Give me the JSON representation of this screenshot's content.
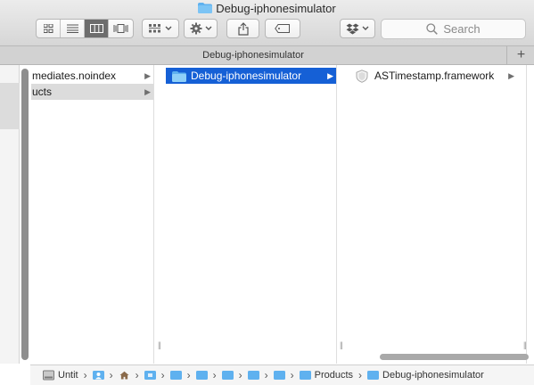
{
  "window": {
    "title": "Debug-iphonesimulator"
  },
  "toolbar": {
    "view_modes": [
      "icon-view",
      "list-view",
      "column-view",
      "cover-flow-view"
    ],
    "active_view": "column-view",
    "search_placeholder": "Search"
  },
  "tab": {
    "label": "Debug-iphonesimulator",
    "add_symbol": "+"
  },
  "columns": [
    {
      "items": [
        {
          "label": "mediates.noindex",
          "has_children": true,
          "state": "normal"
        },
        {
          "label": "ucts",
          "has_children": true,
          "state": "gray"
        }
      ]
    },
    {
      "items": [
        {
          "label": "Debug-iphonesimulator",
          "has_children": true,
          "state": "blue"
        }
      ]
    },
    {
      "items": [
        {
          "label": "ASTimestamp.framework",
          "has_children": true,
          "state": "normal"
        }
      ]
    }
  ],
  "pathbar": {
    "disk_label": "Untit",
    "products_label": "Products",
    "current_label": "Debug-iphonesimulator"
  },
  "colors": {
    "selection": "#1560d6",
    "folder": "#5fb1ef"
  }
}
